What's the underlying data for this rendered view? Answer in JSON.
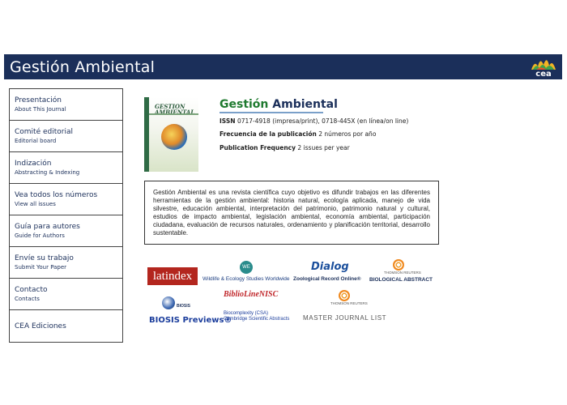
{
  "header": {
    "title": "Gestión Ambiental",
    "logo_text": "cea"
  },
  "sidebar": {
    "items": [
      {
        "label": "Presentación",
        "sub": "About This Journal"
      },
      {
        "label": "Comité editorial",
        "sub": "Editorial board"
      },
      {
        "label": "Indización",
        "sub": "Abstracting & Indexing"
      },
      {
        "label": "Vea todos los números",
        "sub": "View all issues"
      },
      {
        "label": "Guía para autores",
        "sub": "Guide for Authors"
      },
      {
        "label": "Envíe su trabajo",
        "sub": "Submit Your Paper"
      },
      {
        "label": "Contacto",
        "sub": "Contacts"
      },
      {
        "label": "CEA Ediciones",
        "sub": ""
      }
    ]
  },
  "journal": {
    "cover_title_1": "GESTION",
    "cover_title_2": "AMBIENTAL",
    "title_part1": "Gestión",
    "title_part2": "Ambiental",
    "issn_label": "ISSN",
    "issn_value": "0717-4918 (impresa/print), 0718-445X (en línea/on line)",
    "freq_es_label": "Frecuencia de la publicación",
    "freq_es_value": "2 números por año",
    "freq_en_label": "Publication Frequency",
    "freq_en_value": "2 issues per year"
  },
  "description": "Gestión Ambiental es una revista científica cuyo objetivo es difundir trabajos en las diferentes herramientas de la gestión ambiental: historia natural, ecología aplicada, manejo de vida silvestre, educación ambiental, interpretación del patrimonio, patrimonio natural y cultural, estudios de impacto ambiental, legislación ambiental, economía ambiental, participación ciudadana, evaluación de recursos naturales, ordenamiento y planificación territorial, desarrollo sustentable.",
  "indexes": {
    "latindex": "latindex",
    "wildlife": "Wildlife & Ecology Studies Worldwide",
    "dialog": "Dialog",
    "zoological": "Zoological Record Online®",
    "thomson": "THOMSON REUTERS",
    "biological": "BIOLOGICAL ABSTRACT",
    "biosis_label": "BIOSIS",
    "biosis_previews": "BIOSIS Previews®",
    "biblioline": "BiblioLineNISC",
    "bio_l1": "Biocomplexity (CSA)",
    "bio_l2": "Cambridge Scientific Abstracts",
    "master_journal": "MASTER JOURNAL LIST"
  }
}
